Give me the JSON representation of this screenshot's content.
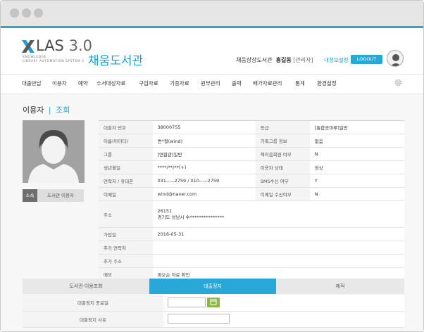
{
  "header": {
    "logo_text": "LAS",
    "logo_version": "3.0",
    "logo_sub_line1": "KNOWLEDGE",
    "logo_sub_line2": "LIBRARY AUTOMATION SYSTEM 3",
    "library_name": "채움도서관",
    "user_library": "채움상상도서관",
    "user_name": "홍길동",
    "user_role": "[관리자]",
    "my_info_link": "내정보설정",
    "logout_label": "LOGOUT"
  },
  "menu": {
    "items": [
      "대출반납",
      "이용자",
      "예약",
      "수서대상자료",
      "구입자료",
      "기증자료",
      "원부관리",
      "출력",
      "배가자료관리",
      "통계",
      "환경설정"
    ]
  },
  "breadcrumb": {
    "section": "이용자",
    "separator": "|",
    "current": "조회"
  },
  "profile": {
    "tag_label": "소속",
    "tag_value": "도서관 이용자"
  },
  "info": {
    "loan_card_label": "대출자 번호",
    "loan_card_value": "38000755",
    "grade_label": "등급",
    "grade_value": "[통합공마루]일반",
    "name_label": "이름(아이디)",
    "name_value": "변*철(wind)",
    "family_label": "가족그룹 정보",
    "family_value": "없음",
    "group_label": "그룹",
    "group_value": "[연합관]일반",
    "member_label": "책이음회원 여부",
    "member_value": "N",
    "birth_label": "생년월일",
    "birth_value": "****/**/**(+)",
    "user_status_label": "이용자 상태",
    "user_status_value": "정상",
    "phone_label": "연락처 / 휴대폰",
    "phone_value": "031-----2759 / 010-----2759",
    "sms_label": "SMS수신 여부",
    "sms_value": "Y",
    "email_label": "이메일",
    "email_value": "wind@naver.com",
    "email_recv_label": "이메일 수신여부",
    "email_recv_value": "N",
    "address_label": "주소",
    "address_zip": "26151",
    "address_line": "경기도 성남시 수***************",
    "join_label": "가입일",
    "join_value": "2016-05-31",
    "extra_phone_label": "추가 연락처",
    "extra_phone_value": "",
    "extra_address_label": "추가 주소",
    "extra_address_value": "",
    "memo_label": "메모",
    "memo_value": "파오손 자료 확인"
  },
  "tabs": {
    "items": [
      "도서관 이용조회",
      "대출정지",
      "제적"
    ],
    "active_index": 1
  },
  "form": {
    "end_date_label": "대출정지 종료일",
    "end_date_value": "",
    "reason_label": "대출정지 사유",
    "reason_value": ""
  },
  "colors": {
    "accent": "#29a7d6",
    "calendar_button": "#8bb84a",
    "photo_bg": "#9e9e9e"
  },
  "icons": {
    "settings": "gear-icon",
    "calendar": "calendar-icon",
    "avatar": "user-silhouette-icon"
  }
}
